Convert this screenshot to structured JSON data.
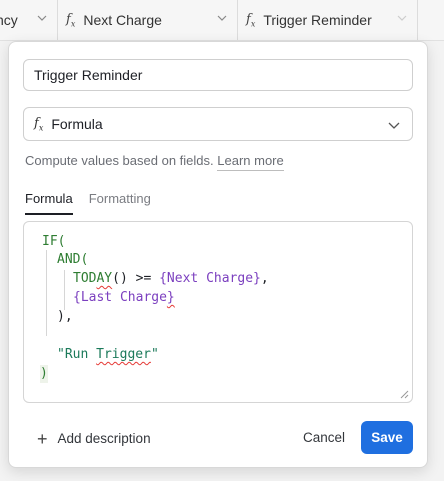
{
  "grid": {
    "columns": [
      {
        "label": "ncy"
      },
      {
        "label": "Next Charge",
        "icon": "fx-icon"
      },
      {
        "label": "Trigger Reminder",
        "icon": "fx-icon"
      }
    ]
  },
  "popup": {
    "field_name": "Trigger Reminder",
    "field_type": "Formula",
    "help_text": "Compute values based on fields.",
    "help_link": "Learn more",
    "tabs": [
      {
        "label": "Formula",
        "active": true
      },
      {
        "label": "Formatting",
        "active": false
      }
    ],
    "formula": {
      "l1_fn": "IF(",
      "l2_fn": "AND(",
      "l3_fn_a": "TOD",
      "l3_fn_b": "AY",
      "l3_rest": "() >= ",
      "l3_ref": "{Next Charge}",
      "l3_tail": ",",
      "l4_ref_a": "{Last Charge",
      "l4_ref_b": "}",
      "l5": "),",
      "l7_str_a": "\"Run ",
      "l7_str_b": "Trigger",
      "l7_str_c": "\"",
      "l8": ")"
    },
    "add_description": "Add description",
    "cancel": "Cancel",
    "save": "Save"
  },
  "colors": {
    "save_button": "#1f6fe0",
    "function": "#2e7d32",
    "field_reference": "#7b3fbf",
    "string": "#1b7a5a",
    "spellcheck": "#e53935"
  }
}
